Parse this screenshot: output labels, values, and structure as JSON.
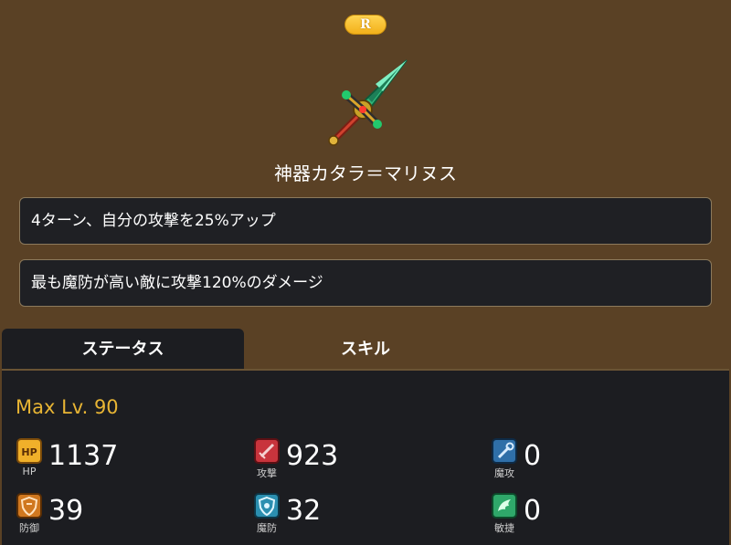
{
  "item": {
    "rarity": "R",
    "name": "神器カタラ＝マリヌス",
    "skills": [
      "4ターン、自分の攻撃を25%アップ",
      "最も魔防が高い敵に攻撃120%のダメージ"
    ]
  },
  "tabs": [
    {
      "label": "ステータス",
      "active": true
    },
    {
      "label": "スキル",
      "active": false
    }
  ],
  "status": {
    "max_level": "Max Lv. 90",
    "stats": [
      {
        "key": "hp",
        "label": "HP",
        "value": "1137",
        "icon": "hp-icon"
      },
      {
        "key": "attack",
        "label": "攻撃",
        "value": "923",
        "icon": "sword-icon"
      },
      {
        "key": "magic_attack",
        "label": "魔攻",
        "value": "0",
        "icon": "wand-icon"
      },
      {
        "key": "defense",
        "label": "防御",
        "value": "39",
        "icon": "shield-icon"
      },
      {
        "key": "magic_defense",
        "label": "魔防",
        "value": "32",
        "icon": "magic-shield-icon"
      },
      {
        "key": "agility",
        "label": "敏捷",
        "value": "0",
        "icon": "wing-icon"
      }
    ]
  },
  "colors": {
    "background": "#5a4125",
    "panel": "#1c1d21",
    "accent_gold": "#e8b534"
  }
}
